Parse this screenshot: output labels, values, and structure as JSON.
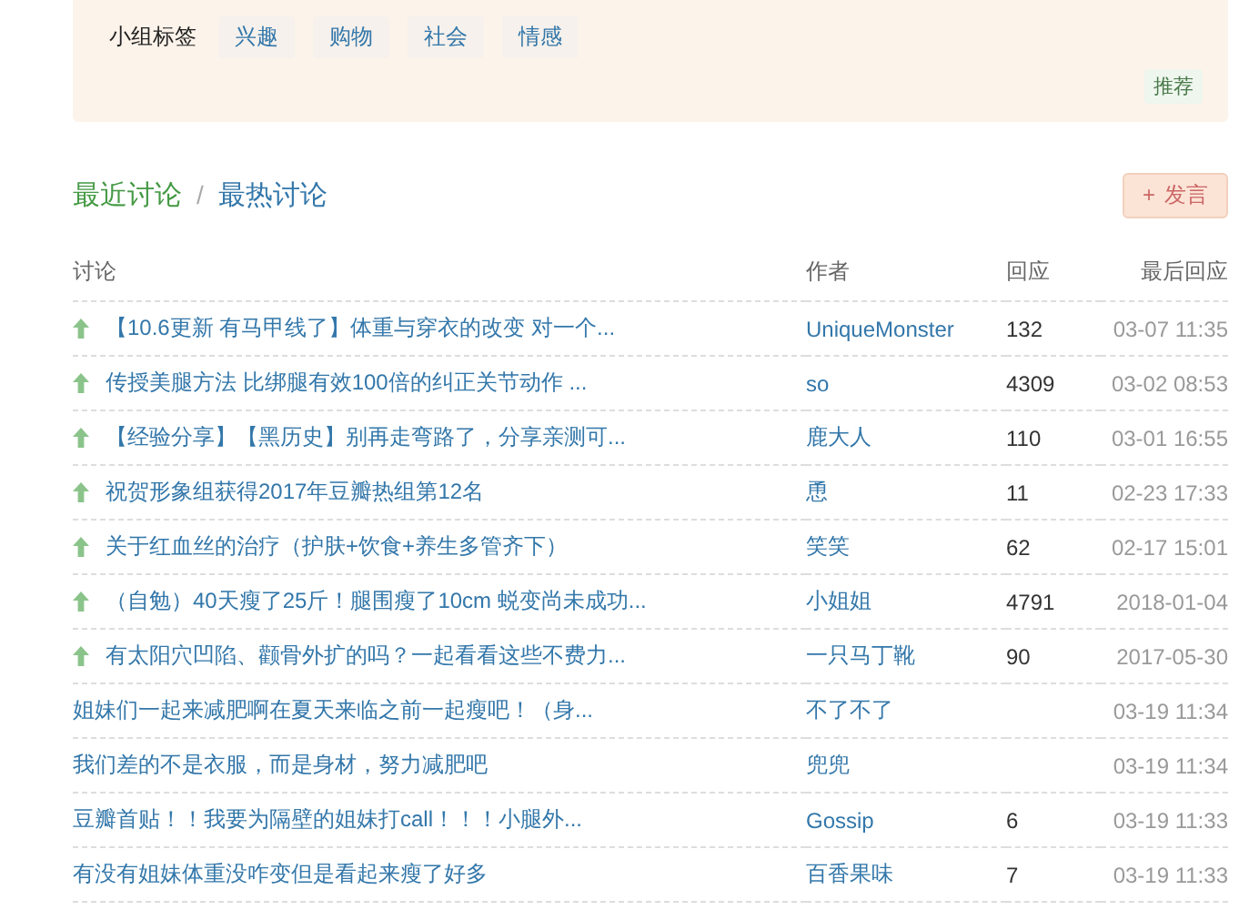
{
  "tag_panel": {
    "label": "小组标签",
    "tags": [
      "兴趣",
      "购物",
      "社会",
      "情感"
    ],
    "recommend_button": "推荐"
  },
  "discussions": {
    "tabs": [
      {
        "label": "最近讨论",
        "selected": true
      },
      {
        "label": "最热讨论",
        "selected": false
      }
    ],
    "separator": "/",
    "post_button": {
      "icon": "+",
      "label": "发言"
    },
    "table": {
      "columns": [
        "讨论",
        "作者",
        "回应",
        "最后回应"
      ],
      "rows": [
        {
          "pinned": true,
          "title": "【10.6更新 有马甲线了】体重与穿衣的改变 对一个...",
          "author": "UniqueMonster",
          "replies": "132",
          "last_reply": "03-07 11:35"
        },
        {
          "pinned": true,
          "title": "传授美腿方法 比绑腿有效100倍的纠正关节动作 ...",
          "author": "so",
          "replies": "4309",
          "last_reply": "03-02 08:53"
        },
        {
          "pinned": true,
          "title": "【经验分享】【黑历史】别再走弯路了，分享亲测可...",
          "author": "鹿大人",
          "replies": "110",
          "last_reply": "03-01 16:55"
        },
        {
          "pinned": true,
          "title": "祝贺形象组获得2017年豆瓣热组第12名",
          "author": "恿",
          "replies": "11",
          "last_reply": "02-23 17:33"
        },
        {
          "pinned": true,
          "title": "关于红血丝的治疗（护肤+饮食+养生多管齐下）",
          "author": "笑笑",
          "replies": "62",
          "last_reply": "02-17 15:01"
        },
        {
          "pinned": true,
          "title": "（自勉）40天瘦了25斤！腿围瘦了10cm 蜕变尚未成功...",
          "author": "小姐姐",
          "replies": "4791",
          "last_reply": "2018-01-04"
        },
        {
          "pinned": true,
          "title": "有太阳穴凹陷、颧骨外扩的吗？一起看看这些不费力...",
          "author": "一只马丁靴",
          "replies": "90",
          "last_reply": "2017-05-30"
        },
        {
          "pinned": false,
          "title": "姐妹们一起来减肥啊在夏天来临之前一起瘦吧！（身...",
          "author": "不了不了",
          "last_reply": "03-19 11:34"
        },
        {
          "pinned": false,
          "title": "我们差的不是衣服，而是身材，努力减肥吧",
          "author": "兜兜",
          "last_reply": "03-19 11:34"
        },
        {
          "pinned": false,
          "title": "豆瓣首贴！！我要为隔壁的姐妹打call！！！小腿外...",
          "author": "Gossip",
          "replies": "6",
          "last_reply": "03-19 11:33"
        },
        {
          "pinned": false,
          "title": "有没有姐妹体重没咋变但是看起来瘦了好多",
          "author": "百香果味",
          "replies": "7",
          "last_reply": "03-19 11:33"
        }
      ]
    }
  }
}
